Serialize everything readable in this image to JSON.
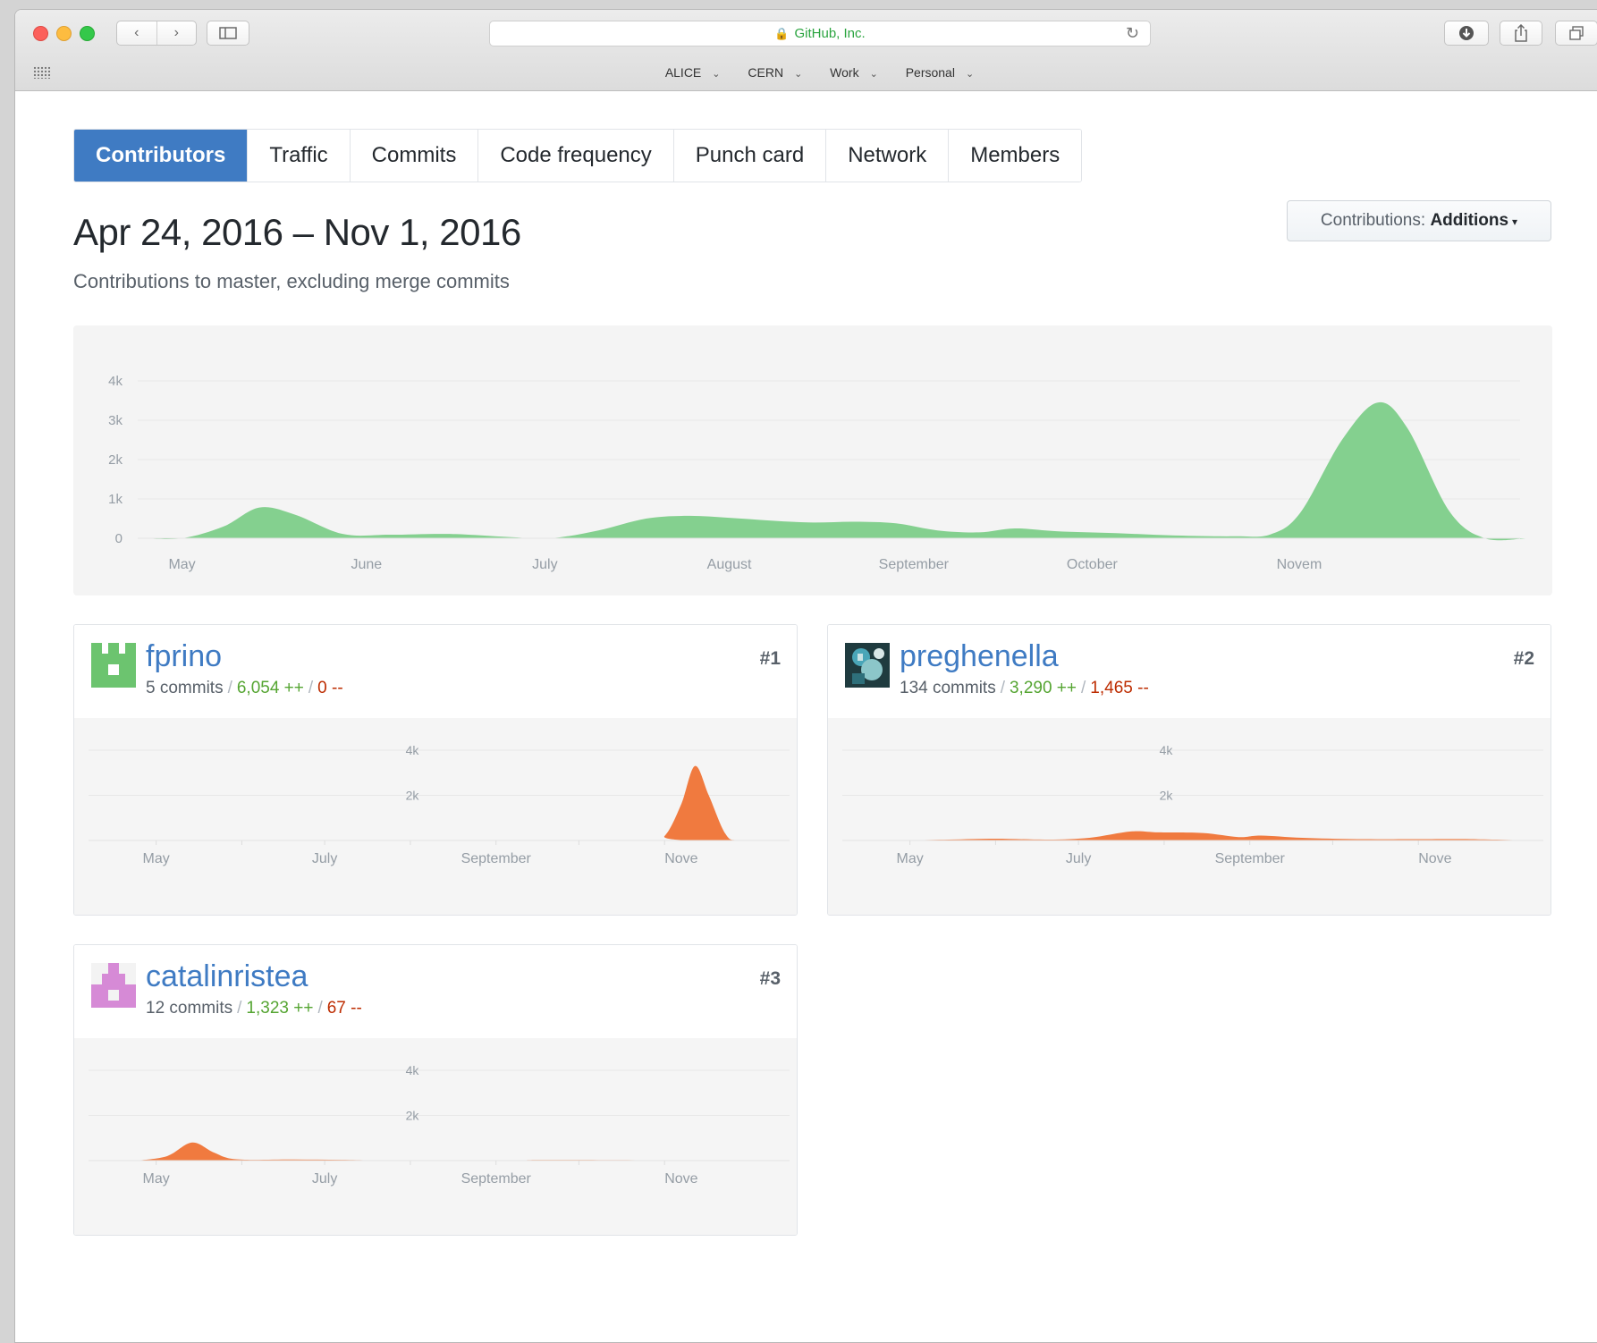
{
  "browser": {
    "address_text": "GitHub, Inc.",
    "bookmarks": [
      "ALICE",
      "CERN",
      "Work",
      "Personal"
    ]
  },
  "tabs": [
    {
      "label": "Contributors",
      "selected": true
    },
    {
      "label": "Traffic"
    },
    {
      "label": "Commits"
    },
    {
      "label": "Code frequency"
    },
    {
      "label": "Punch card"
    },
    {
      "label": "Network"
    },
    {
      "label": "Members"
    }
  ],
  "header": {
    "title": "Apr 24, 2016 – Nov 1, 2016",
    "subtitle": "Contributions to master, excluding merge commits"
  },
  "dropdown": {
    "prefix": "Contributions:",
    "value": "Additions"
  },
  "colors": {
    "overall": "#84d08f",
    "contributor": "#f07a3f",
    "accent": "#3f7bc3",
    "additions": "#55a532",
    "deletions": "#bd2c00"
  },
  "chart_data": [
    {
      "type": "area",
      "ylim": [
        0,
        4000
      ],
      "yticks": [
        "0",
        "1k",
        "2k",
        "3k",
        "4k"
      ],
      "x_ticks": [
        "May",
        "June",
        "July",
        "August",
        "September",
        "October",
        "Novem"
      ],
      "points": [
        [
          "2016-04-24",
          0
        ],
        [
          "2016-05-01",
          0
        ],
        [
          "2016-05-08",
          300
        ],
        [
          "2016-05-14",
          780
        ],
        [
          "2016-05-20",
          600
        ],
        [
          "2016-05-28",
          110
        ],
        [
          "2016-06-05",
          90
        ],
        [
          "2016-06-15",
          110
        ],
        [
          "2016-06-25",
          30
        ],
        [
          "2016-07-02",
          0
        ],
        [
          "2016-07-10",
          200
        ],
        [
          "2016-07-18",
          500
        ],
        [
          "2016-07-25",
          570
        ],
        [
          "2016-08-01",
          520
        ],
        [
          "2016-08-08",
          450
        ],
        [
          "2016-08-15",
          400
        ],
        [
          "2016-08-22",
          420
        ],
        [
          "2016-08-29",
          380
        ],
        [
          "2016-09-05",
          200
        ],
        [
          "2016-09-12",
          150
        ],
        [
          "2016-09-18",
          250
        ],
        [
          "2016-09-25",
          180
        ],
        [
          "2016-10-05",
          130
        ],
        [
          "2016-10-15",
          70
        ],
        [
          "2016-10-25",
          50
        ],
        [
          "2016-10-31",
          100
        ],
        [
          "2016-11-05",
          650
        ],
        [
          "2016-11-12",
          2500
        ],
        [
          "2016-11-18",
          3450
        ],
        [
          "2016-11-23",
          2800
        ],
        [
          "2016-11-30",
          700
        ],
        [
          "2016-12-06",
          0
        ],
        [
          "2016-12-13",
          0
        ]
      ]
    }
  ],
  "contributors": [
    {
      "rank": "#1",
      "username": "fprino",
      "commits": "5 commits",
      "additions": "6,054 ++",
      "deletions": "0 --",
      "chart_data": {
        "type": "area",
        "ylim": [
          0,
          4000
        ],
        "yticks": [
          "2k",
          "4k"
        ],
        "x_ticks": [
          "May",
          "July",
          "September",
          "Nove"
        ],
        "points": [
          [
            "2016-04-24",
            0
          ],
          [
            "2016-10-25",
            0
          ],
          [
            "2016-11-01",
            200
          ],
          [
            "2016-11-07",
            1600
          ],
          [
            "2016-11-12",
            3300
          ],
          [
            "2016-11-17",
            2000
          ],
          [
            "2016-11-23",
            300
          ],
          [
            "2016-11-28",
            0
          ],
          [
            "2016-12-13",
            0
          ]
        ]
      }
    },
    {
      "rank": "#2",
      "username": "preghenella",
      "commits": "134 commits",
      "additions": "3,290 ++",
      "deletions": "1,465 --",
      "chart_data": {
        "type": "area",
        "ylim": [
          0,
          4000
        ],
        "yticks": [
          "2k",
          "4k"
        ],
        "x_ticks": [
          "May",
          "July",
          "September",
          "Nove"
        ],
        "points": [
          [
            "2016-04-24",
            0
          ],
          [
            "2016-05-15",
            40
          ],
          [
            "2016-06-01",
            80
          ],
          [
            "2016-06-20",
            40
          ],
          [
            "2016-07-05",
            120
          ],
          [
            "2016-07-20",
            400
          ],
          [
            "2016-07-30",
            360
          ],
          [
            "2016-08-15",
            330
          ],
          [
            "2016-08-28",
            150
          ],
          [
            "2016-09-05",
            220
          ],
          [
            "2016-09-20",
            120
          ],
          [
            "2016-10-10",
            60
          ],
          [
            "2016-11-01",
            60
          ],
          [
            "2016-11-20",
            60
          ],
          [
            "2016-12-13",
            0
          ]
        ]
      }
    },
    {
      "rank": "#3",
      "username": "catalinristea",
      "commits": "12 commits",
      "additions": "1,323 ++",
      "deletions": "67 --",
      "chart_data": {
        "type": "area",
        "ylim": [
          0,
          4000
        ],
        "yticks": [
          "2k",
          "4k"
        ],
        "x_ticks": [
          "May",
          "July",
          "September",
          "Nove"
        ],
        "points": [
          [
            "2016-04-24",
            0
          ],
          [
            "2016-05-05",
            200
          ],
          [
            "2016-05-14",
            800
          ],
          [
            "2016-05-22",
            350
          ],
          [
            "2016-05-30",
            60
          ],
          [
            "2016-06-20",
            50
          ],
          [
            "2016-07-10",
            30
          ],
          [
            "2016-08-01",
            0
          ],
          [
            "2016-09-10",
            0
          ],
          [
            "2016-09-20",
            30
          ],
          [
            "2016-12-13",
            0
          ]
        ]
      }
    }
  ]
}
